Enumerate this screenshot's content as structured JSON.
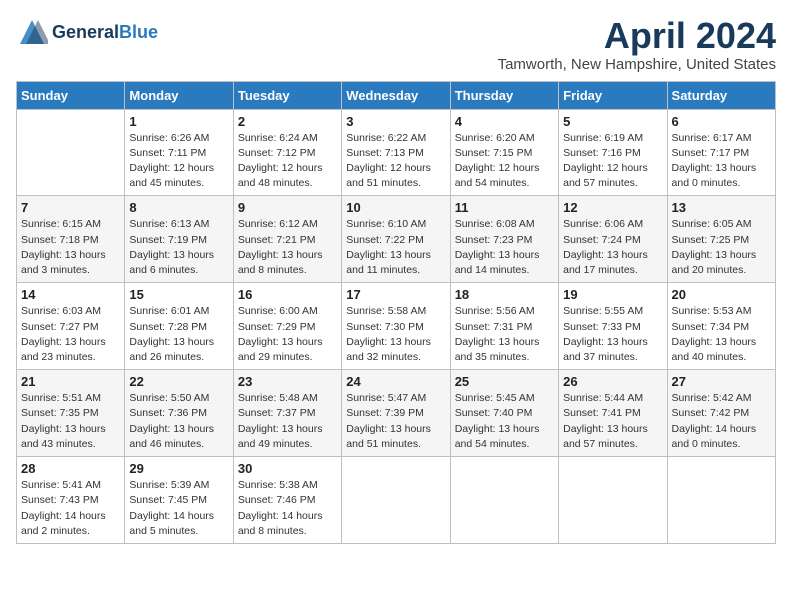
{
  "logo": {
    "general": "General",
    "blue": "Blue"
  },
  "title": "April 2024",
  "location": "Tamworth, New Hampshire, United States",
  "weekdays": [
    "Sunday",
    "Monday",
    "Tuesday",
    "Wednesday",
    "Thursday",
    "Friday",
    "Saturday"
  ],
  "weeks": [
    [
      {
        "day": "",
        "info": ""
      },
      {
        "day": "1",
        "info": "Sunrise: 6:26 AM\nSunset: 7:11 PM\nDaylight: 12 hours\nand 45 minutes."
      },
      {
        "day": "2",
        "info": "Sunrise: 6:24 AM\nSunset: 7:12 PM\nDaylight: 12 hours\nand 48 minutes."
      },
      {
        "day": "3",
        "info": "Sunrise: 6:22 AM\nSunset: 7:13 PM\nDaylight: 12 hours\nand 51 minutes."
      },
      {
        "day": "4",
        "info": "Sunrise: 6:20 AM\nSunset: 7:15 PM\nDaylight: 12 hours\nand 54 minutes."
      },
      {
        "day": "5",
        "info": "Sunrise: 6:19 AM\nSunset: 7:16 PM\nDaylight: 12 hours\nand 57 minutes."
      },
      {
        "day": "6",
        "info": "Sunrise: 6:17 AM\nSunset: 7:17 PM\nDaylight: 13 hours\nand 0 minutes."
      }
    ],
    [
      {
        "day": "7",
        "info": "Sunrise: 6:15 AM\nSunset: 7:18 PM\nDaylight: 13 hours\nand 3 minutes."
      },
      {
        "day": "8",
        "info": "Sunrise: 6:13 AM\nSunset: 7:19 PM\nDaylight: 13 hours\nand 6 minutes."
      },
      {
        "day": "9",
        "info": "Sunrise: 6:12 AM\nSunset: 7:21 PM\nDaylight: 13 hours\nand 8 minutes."
      },
      {
        "day": "10",
        "info": "Sunrise: 6:10 AM\nSunset: 7:22 PM\nDaylight: 13 hours\nand 11 minutes."
      },
      {
        "day": "11",
        "info": "Sunrise: 6:08 AM\nSunset: 7:23 PM\nDaylight: 13 hours\nand 14 minutes."
      },
      {
        "day": "12",
        "info": "Sunrise: 6:06 AM\nSunset: 7:24 PM\nDaylight: 13 hours\nand 17 minutes."
      },
      {
        "day": "13",
        "info": "Sunrise: 6:05 AM\nSunset: 7:25 PM\nDaylight: 13 hours\nand 20 minutes."
      }
    ],
    [
      {
        "day": "14",
        "info": "Sunrise: 6:03 AM\nSunset: 7:27 PM\nDaylight: 13 hours\nand 23 minutes."
      },
      {
        "day": "15",
        "info": "Sunrise: 6:01 AM\nSunset: 7:28 PM\nDaylight: 13 hours\nand 26 minutes."
      },
      {
        "day": "16",
        "info": "Sunrise: 6:00 AM\nSunset: 7:29 PM\nDaylight: 13 hours\nand 29 minutes."
      },
      {
        "day": "17",
        "info": "Sunrise: 5:58 AM\nSunset: 7:30 PM\nDaylight: 13 hours\nand 32 minutes."
      },
      {
        "day": "18",
        "info": "Sunrise: 5:56 AM\nSunset: 7:31 PM\nDaylight: 13 hours\nand 35 minutes."
      },
      {
        "day": "19",
        "info": "Sunrise: 5:55 AM\nSunset: 7:33 PM\nDaylight: 13 hours\nand 37 minutes."
      },
      {
        "day": "20",
        "info": "Sunrise: 5:53 AM\nSunset: 7:34 PM\nDaylight: 13 hours\nand 40 minutes."
      }
    ],
    [
      {
        "day": "21",
        "info": "Sunrise: 5:51 AM\nSunset: 7:35 PM\nDaylight: 13 hours\nand 43 minutes."
      },
      {
        "day": "22",
        "info": "Sunrise: 5:50 AM\nSunset: 7:36 PM\nDaylight: 13 hours\nand 46 minutes."
      },
      {
        "day": "23",
        "info": "Sunrise: 5:48 AM\nSunset: 7:37 PM\nDaylight: 13 hours\nand 49 minutes."
      },
      {
        "day": "24",
        "info": "Sunrise: 5:47 AM\nSunset: 7:39 PM\nDaylight: 13 hours\nand 51 minutes."
      },
      {
        "day": "25",
        "info": "Sunrise: 5:45 AM\nSunset: 7:40 PM\nDaylight: 13 hours\nand 54 minutes."
      },
      {
        "day": "26",
        "info": "Sunrise: 5:44 AM\nSunset: 7:41 PM\nDaylight: 13 hours\nand 57 minutes."
      },
      {
        "day": "27",
        "info": "Sunrise: 5:42 AM\nSunset: 7:42 PM\nDaylight: 14 hours\nand 0 minutes."
      }
    ],
    [
      {
        "day": "28",
        "info": "Sunrise: 5:41 AM\nSunset: 7:43 PM\nDaylight: 14 hours\nand 2 minutes."
      },
      {
        "day": "29",
        "info": "Sunrise: 5:39 AM\nSunset: 7:45 PM\nDaylight: 14 hours\nand 5 minutes."
      },
      {
        "day": "30",
        "info": "Sunrise: 5:38 AM\nSunset: 7:46 PM\nDaylight: 14 hours\nand 8 minutes."
      },
      {
        "day": "",
        "info": ""
      },
      {
        "day": "",
        "info": ""
      },
      {
        "day": "",
        "info": ""
      },
      {
        "day": "",
        "info": ""
      }
    ]
  ]
}
